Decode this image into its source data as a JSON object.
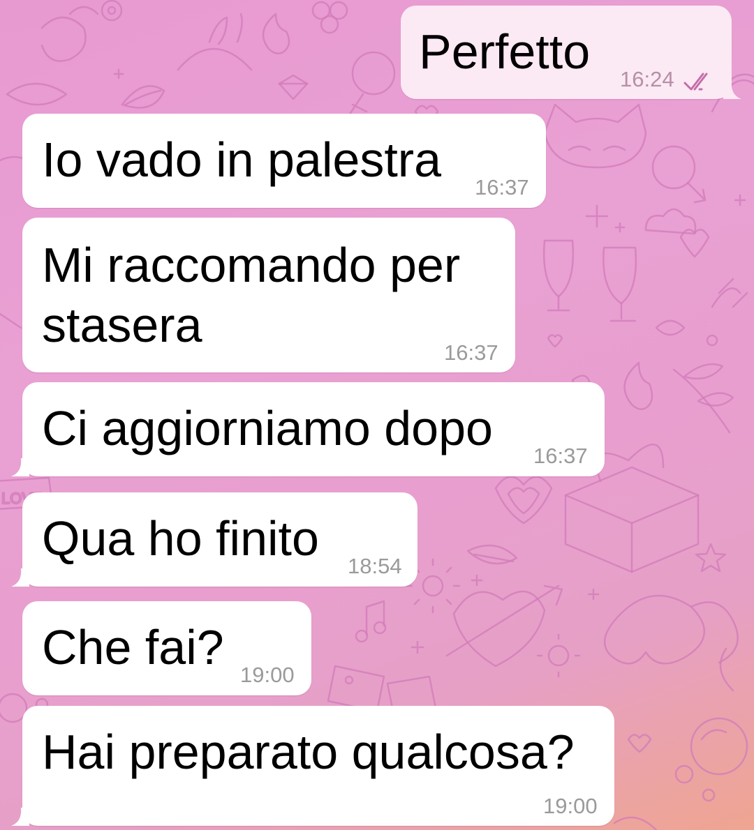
{
  "messages": [
    {
      "id": "m1",
      "direction": "outgoing",
      "text": "Perfetto",
      "time": "16:24",
      "status": "read"
    },
    {
      "id": "m2",
      "direction": "incoming",
      "text": "Io vado in palestra",
      "time": "16:37"
    },
    {
      "id": "m3",
      "direction": "incoming",
      "lines": [
        "Mi raccomando per",
        "stasera"
      ],
      "time": "16:37"
    },
    {
      "id": "m4",
      "direction": "incoming",
      "text": "Ci aggiorniamo dopo",
      "time": "16:37"
    },
    {
      "id": "m5",
      "direction": "incoming",
      "text": "Qua ho finito",
      "time": "18:54"
    },
    {
      "id": "m6",
      "direction": "incoming",
      "text": "Che fai?",
      "time": "19:00"
    },
    {
      "id": "m7",
      "direction": "incoming",
      "text": "Hai preparato qualcosa?",
      "time": "19:00"
    }
  ],
  "wallpaper": {
    "doodle_text": "LOVE",
    "gradient_colors": [
      "#e79ad0",
      "#e9a0d3",
      "#efa590"
    ],
    "pattern_color": "#d27bb9"
  },
  "colors": {
    "incoming_bubble": "#ffffff",
    "outgoing_bubble": "#fbe9f4",
    "read_ticks": "#c46ea9",
    "time_text": "#9a9a9a"
  }
}
